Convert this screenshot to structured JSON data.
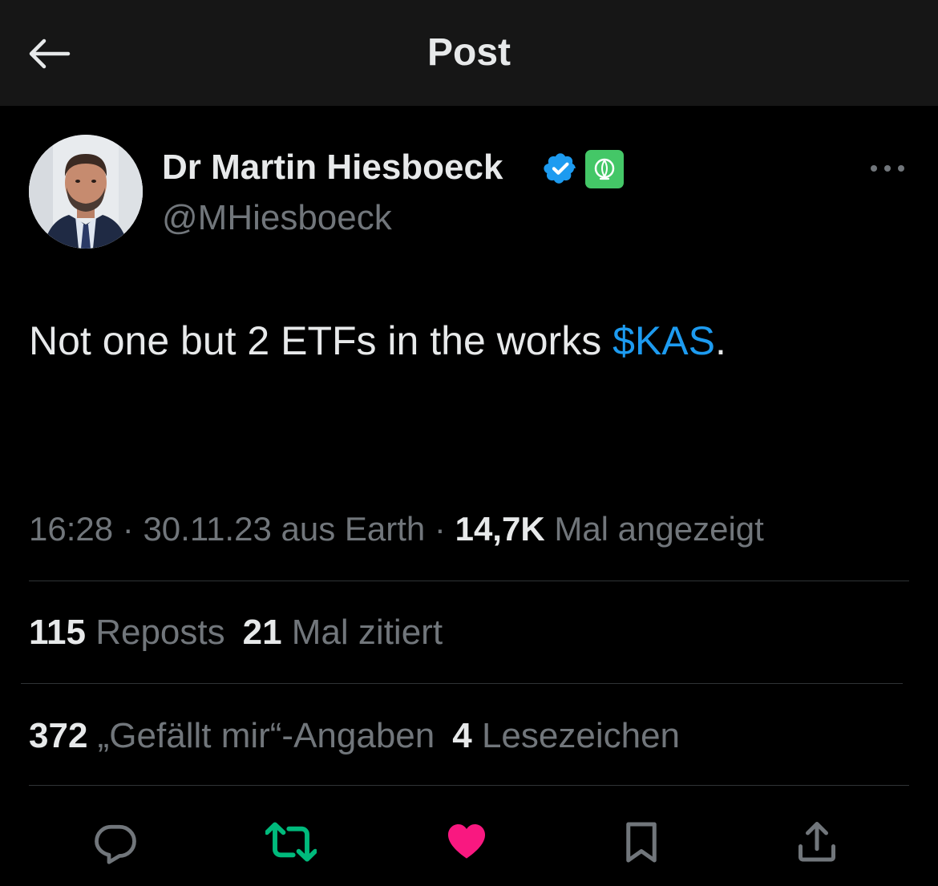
{
  "header": {
    "title": "Post",
    "back_icon": "arrow-left-icon"
  },
  "author": {
    "name": "Dr Martin Hiesboeck",
    "handle": "@MHiesboeck",
    "verified_icon": "verified-badge-icon",
    "affiliation_icon": "affiliation-badge-icon",
    "avatar": "avatar"
  },
  "tweet": {
    "text_before": "Not one but 2 ETFs in the works ",
    "cashtag": "$KAS",
    "text_after": "."
  },
  "meta": {
    "time": "16:28",
    "sep1": " · ",
    "date": "30.11.23",
    "source": " aus Earth",
    "sep2": " · ",
    "views_count": "14,7K",
    "views_label": " Mal angezeigt"
  },
  "stats_row1": {
    "reposts_count": "115",
    "reposts_label": " Reposts",
    "quotes_count": "21",
    "quotes_label": " Mal zitiert"
  },
  "stats_row2": {
    "likes_count": "372",
    "likes_label": " „Gefällt mir“-Angaben",
    "bookmarks_count": "4",
    "bookmarks_label": " Lesezeichen"
  },
  "actions": {
    "reply_icon": "reply-icon",
    "repost_icon": "repost-icon",
    "like_icon": "like-icon",
    "bookmark_icon": "bookmark-icon",
    "share_icon": "share-icon"
  },
  "colors": {
    "background": "#000000",
    "header_bg": "#161616",
    "text_primary": "#e7e9ea",
    "text_secondary": "#71767b",
    "link": "#1d9bf0",
    "repost_active": "#00ba7c",
    "like_active": "#f91880",
    "verified": "#1d9bf0",
    "affiliation_bg": "#44c767",
    "divider": "#2f3336"
  }
}
